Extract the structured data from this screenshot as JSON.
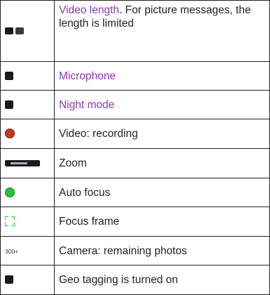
{
  "rows": [
    {
      "icon": "video-length-icons",
      "link_text": "Video length",
      "text": ". For picture messages, the length is limited"
    },
    {
      "icon": "microphone-icon",
      "link_text": "Microphone",
      "text": ""
    },
    {
      "icon": "night-mode-icon",
      "link_text": "Night mode",
      "text": ""
    },
    {
      "icon": "recording-dot-icon",
      "link_text": "",
      "text": "Video: recording"
    },
    {
      "icon": "zoom-slider-icon",
      "link_text": "",
      "text": "Zoom"
    },
    {
      "icon": "auto-focus-dot-icon",
      "link_text": "",
      "text": "Auto focus"
    },
    {
      "icon": "focus-frame-icon",
      "link_text": "",
      "text": "Focus frame"
    },
    {
      "icon": "remaining-photos-counter",
      "icon_text": "300+",
      "link_text": "",
      "text": "Camera: remaining photos"
    },
    {
      "icon": "geo-tag-icon",
      "link_text": "",
      "text": "Geo tagging is turned on"
    }
  ],
  "colors": {
    "link": "#8b3aa8",
    "text": "#222222",
    "border": "#222222",
    "recording_red": "#c8381f",
    "focus_green": "#27c23a"
  }
}
